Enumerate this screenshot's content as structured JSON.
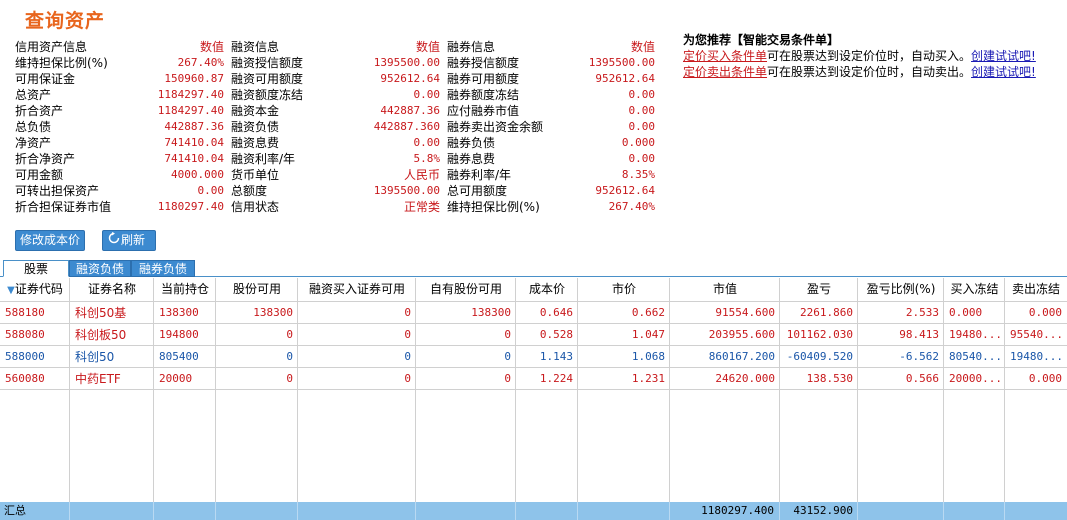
{
  "page_title": "查询资产",
  "columns": [
    {
      "header_label": "信用资产信息",
      "header_value": "数值",
      "rows": [
        {
          "label": "维持担保比例(%)",
          "value": "267.40%"
        },
        {
          "label": "可用保证金",
          "value": "150960.87"
        },
        {
          "label": "总资产",
          "value": "1184297.40"
        },
        {
          "label": "折合资产",
          "value": "1184297.40"
        },
        {
          "label": "总负债",
          "value": "442887.36"
        },
        {
          "label": "净资产",
          "value": "741410.04"
        },
        {
          "label": "折合净资产",
          "value": "741410.04"
        },
        {
          "label": "可用金额",
          "value": "4000.000"
        },
        {
          "label": "可转出担保资产",
          "value": "0.00"
        },
        {
          "label": "折合担保证券市值",
          "value": "1180297.40"
        }
      ]
    },
    {
      "header_label": "融资信息",
      "header_value": "数值",
      "rows": [
        {
          "label": "融资授信额度",
          "value": "1395500.00"
        },
        {
          "label": "融资可用额度",
          "value": "952612.64"
        },
        {
          "label": "融资额度冻结",
          "value": "0.00"
        },
        {
          "label": "融资本金",
          "value": "442887.36"
        },
        {
          "label": "融资负债",
          "value": "442887.360"
        },
        {
          "label": "融资息费",
          "value": "0.00"
        },
        {
          "label": "融资利率/年",
          "value": "5.8%"
        },
        {
          "label": "货币单位",
          "value": "人民币"
        },
        {
          "label": "总额度",
          "value": "1395500.00"
        },
        {
          "label": "信用状态",
          "value": "正常类"
        }
      ]
    },
    {
      "header_label": "融券信息",
      "header_value": "数值",
      "rows": [
        {
          "label": "融券授信额度",
          "value": "1395500.00"
        },
        {
          "label": "融券可用额度",
          "value": "952612.64"
        },
        {
          "label": "融券额度冻结",
          "value": "0.00"
        },
        {
          "label": "应付融券市值",
          "value": "0.00"
        },
        {
          "label": "融券卖出资金余额",
          "value": "0.00"
        },
        {
          "label": "融券负债",
          "value": "0.000"
        },
        {
          "label": "融券息费",
          "value": "0.00"
        },
        {
          "label": "融券利率/年",
          "value": "8.35%"
        },
        {
          "label": "总可用额度",
          "value": "952612.64"
        },
        {
          "label": "维持担保比例(%)",
          "value": "267.40%"
        }
      ]
    }
  ],
  "promo": {
    "title": "为您推荐【智能交易条件单】",
    "line1_link": "定价买入条件单",
    "line1_text": "可在股票达到设定价位时，自动买入。",
    "line1_action": "创建试试吧!",
    "line2_link": "定价卖出条件单",
    "line2_text": "可在股票达到设定价位时，自动卖出。",
    "line2_action": "创建试试吧!"
  },
  "buttons": {
    "modify_cost": "修改成本价",
    "refresh": "刷新"
  },
  "tabs": [
    "股票",
    "融资负债",
    "融券负债"
  ],
  "table": {
    "sort_indicator": "▼",
    "headers": [
      "证券代码",
      "证券名称",
      "当前持仓",
      "股份可用",
      "融资买入证券可用",
      "自有股份可用",
      "成本价",
      "市价",
      "市值",
      "盈亏",
      "盈亏比例(%)",
      "买入冻结",
      "卖出冻结"
    ],
    "rows": [
      {
        "code": "588180",
        "name": "科创50基",
        "position": "138300",
        "available": "138300",
        "margin_available": "0",
        "own_available": "138300",
        "cost": "0.646",
        "price": "0.662",
        "market_value": "91554.600",
        "pnl": "2261.860",
        "pnl_ratio": "2.533",
        "buy_frozen": "0.000",
        "sell_frozen": "0.000",
        "color": "red"
      },
      {
        "code": "588080",
        "name": "科创板50",
        "position": "194800",
        "available": "0",
        "margin_available": "0",
        "own_available": "0",
        "cost": "0.528",
        "price": "1.047",
        "market_value": "203955.600",
        "pnl": "101162.030",
        "pnl_ratio": "98.413",
        "buy_frozen": "19480...",
        "sell_frozen": "95540...",
        "color": "red"
      },
      {
        "code": "588000",
        "name": "科创50",
        "position": "805400",
        "available": "0",
        "margin_available": "0",
        "own_available": "0",
        "cost": "1.143",
        "price": "1.068",
        "market_value": "860167.200",
        "pnl": "-60409.520",
        "pnl_ratio": "-6.562",
        "buy_frozen": "80540...",
        "sell_frozen": "19480...",
        "color": "blue"
      },
      {
        "code": "560080",
        "name": "中药ETF",
        "position": "20000",
        "available": "0",
        "margin_available": "0",
        "own_available": "0",
        "cost": "1.224",
        "price": "1.231",
        "market_value": "24620.000",
        "pnl": "138.530",
        "pnl_ratio": "0.566",
        "buy_frozen": "20000...",
        "sell_frozen": "0.000",
        "color": "red"
      }
    ]
  },
  "summary": {
    "label": "汇总",
    "market_value": "1180297.400",
    "pnl": "43152.900"
  },
  "colors": {
    "title": "#e8651d",
    "positive": "#c8191c",
    "negative": "#1a56a8",
    "accent": "#3c8ad0",
    "summary_bar": "#8ec3ea"
  }
}
